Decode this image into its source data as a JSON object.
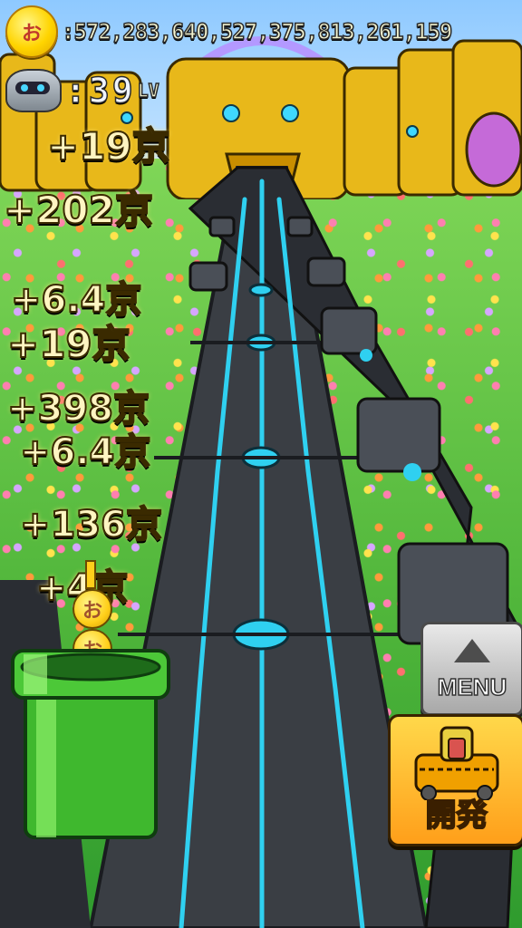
{
  "hud": {
    "money": ":572,283,640,527,375,813,261,159",
    "level_value": ":39",
    "level_unit": "LV",
    "coin_icon": "gold-coin-icon",
    "robot_icon": "robot-head-icon"
  },
  "popups": [
    {
      "text": "+19京"
    },
    {
      "text": "+202京"
    },
    {
      "text": "+6.4京"
    },
    {
      "text": "+19京"
    },
    {
      "text": "+398京"
    },
    {
      "text": "+6.4京"
    },
    {
      "text": "+136京"
    },
    {
      "text": "+4京"
    }
  ],
  "buttons": {
    "menu_label": "MENU",
    "develop_label": "開発"
  },
  "coin_glyph": "お",
  "colors": {
    "road": "#3a3e44",
    "neon": "#2fd0f0",
    "gold": "#ffcf1a",
    "pipe_green": "#3fb82e",
    "grass": "#4fb53a"
  }
}
